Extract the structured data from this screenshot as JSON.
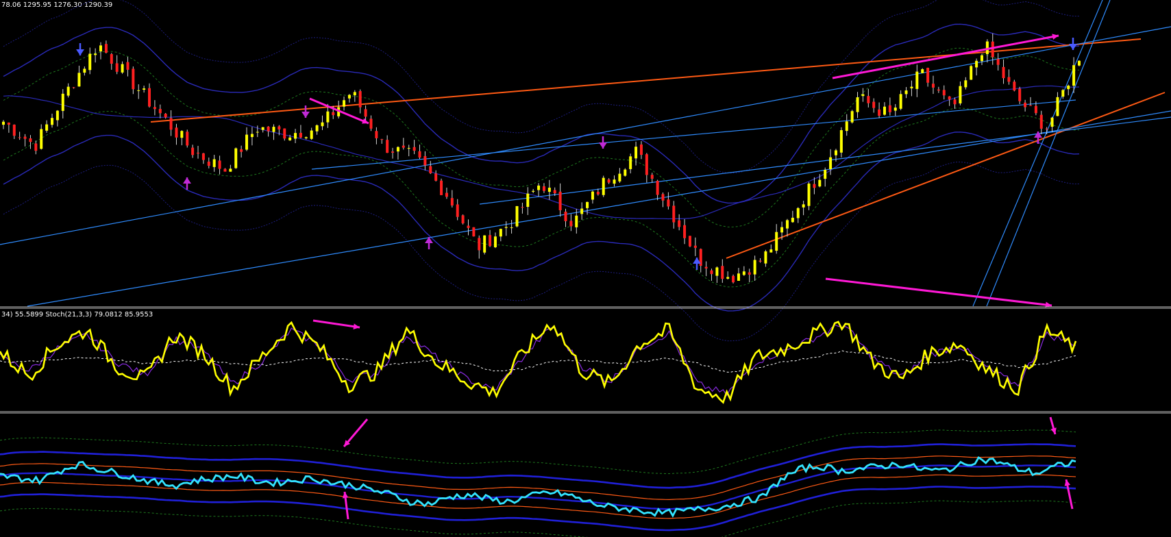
{
  "chart_data": [
    {
      "type": "candlestick",
      "pane": "price",
      "header_text": "78.06 1295.95 1276.30 1290.39",
      "colors": {
        "up": "#ffff00",
        "down": "#ff2020",
        "wick": "#d8d8d8",
        "band_outer": "#2a2ab8",
        "band_inner": "#1d1d80",
        "band_green": "#1e7a1e",
        "trend_orange": "#ff5a14",
        "trend_blue": "#2f8cff",
        "highlight_magenta": "#ff19d6",
        "marker_blue": "#4a5aff",
        "marker_purple": "#c02ad6"
      },
      "ohlc_sampled": [
        {
          "o": 1281,
          "h": 1283,
          "l": 1279,
          "c": 1282
        },
        {
          "o": 1279,
          "h": 1281,
          "l": 1277,
          "c": 1278
        },
        {
          "o": 1285,
          "h": 1288,
          "l": 1284,
          "c": 1287
        },
        {
          "o": 1293,
          "h": 1296,
          "l": 1292,
          "c": 1295
        },
        {
          "o": 1290,
          "h": 1292,
          "l": 1288,
          "c": 1289
        },
        {
          "o": 1284,
          "h": 1286,
          "l": 1282,
          "c": 1283
        },
        {
          "o": 1278,
          "h": 1280,
          "l": 1276,
          "c": 1277
        },
        {
          "o": 1272,
          "h": 1275,
          "l": 1271,
          "c": 1274
        },
        {
          "o": 1279,
          "h": 1282,
          "l": 1278,
          "c": 1281
        },
        {
          "o": 1281,
          "h": 1283,
          "l": 1279,
          "c": 1280
        },
        {
          "o": 1280,
          "h": 1282,
          "l": 1279,
          "c": 1281
        },
        {
          "o": 1286,
          "h": 1288,
          "l": 1285,
          "c": 1287
        },
        {
          "o": 1278,
          "h": 1281,
          "l": 1277,
          "c": 1278
        },
        {
          "o": 1277,
          "h": 1279,
          "l": 1275,
          "c": 1276
        },
        {
          "o": 1271,
          "h": 1273,
          "l": 1269,
          "c": 1270
        },
        {
          "o": 1262,
          "h": 1265,
          "l": 1259,
          "c": 1261
        },
        {
          "o": 1264,
          "h": 1266,
          "l": 1262,
          "c": 1265
        },
        {
          "o": 1270,
          "h": 1273,
          "l": 1269,
          "c": 1272
        },
        {
          "o": 1266,
          "h": 1268,
          "l": 1264,
          "c": 1265
        },
        {
          "o": 1270,
          "h": 1273,
          "l": 1269,
          "c": 1272
        },
        {
          "o": 1274,
          "h": 1278,
          "l": 1273,
          "c": 1277
        },
        {
          "o": 1268,
          "h": 1271,
          "l": 1267,
          "c": 1268
        },
        {
          "o": 1260,
          "h": 1262,
          "l": 1258,
          "c": 1259
        },
        {
          "o": 1256,
          "h": 1258,
          "l": 1254,
          "c": 1256
        },
        {
          "o": 1258,
          "h": 1260,
          "l": 1256,
          "c": 1259
        },
        {
          "o": 1265,
          "h": 1268,
          "l": 1264,
          "c": 1267
        },
        {
          "o": 1272,
          "h": 1276,
          "l": 1271,
          "c": 1275
        },
        {
          "o": 1282,
          "h": 1288,
          "l": 1281,
          "c": 1286
        },
        {
          "o": 1284,
          "h": 1287,
          "l": 1282,
          "c": 1283
        },
        {
          "o": 1288,
          "h": 1291,
          "l": 1287,
          "c": 1290
        },
        {
          "o": 1285,
          "h": 1287,
          "l": 1283,
          "c": 1284
        },
        {
          "o": 1292,
          "h": 1296,
          "l": 1291,
          "c": 1295
        },
        {
          "o": 1287,
          "h": 1289,
          "l": 1285,
          "c": 1286
        },
        {
          "o": 1282,
          "h": 1284,
          "l": 1280,
          "c": 1281
        },
        {
          "o": 1290,
          "h": 1294,
          "l": 1289,
          "c": 1293
        }
      ],
      "price_range": [
        1252,
        1300
      ]
    },
    {
      "type": "line",
      "pane": "stochastic",
      "header_text": "34) 55.5899  Stoch(21,3,3) 79.0812 85.9553",
      "colors": {
        "main": "#ffff00",
        "signal": "#8a2be2",
        "avg": "#ffffff"
      },
      "ylim": [
        0,
        100
      ],
      "main_values": [
        60,
        35,
        70,
        85,
        45,
        30,
        80,
        60,
        20,
        55,
        90,
        65,
        25,
        40,
        85,
        50,
        30,
        15,
        60,
        95,
        40,
        25,
        70,
        85,
        20,
        10,
        55,
        65,
        80,
        95,
        50,
        30,
        60,
        70,
        40,
        20,
        85,
        65
      ],
      "signal_values": [
        55,
        40,
        65,
        80,
        50,
        35,
        75,
        62,
        25,
        50,
        85,
        68,
        30,
        38,
        80,
        55,
        32,
        18,
        55,
        90,
        45,
        28,
        65,
        82,
        25,
        14,
        50,
        62,
        76,
        92,
        55,
        33,
        58,
        68,
        42,
        24,
        80,
        70
      ],
      "avg_values": [
        50,
        50,
        52,
        55,
        52,
        48,
        50,
        52,
        48,
        46,
        50,
        55,
        52,
        46,
        48,
        52,
        48,
        40,
        42,
        50,
        52,
        48,
        50,
        54,
        48,
        38,
        42,
        50,
        55,
        62,
        58,
        50,
        48,
        52,
        50,
        44,
        48,
        56
      ]
    },
    {
      "type": "line",
      "pane": "lower_oscillator",
      "colors": {
        "main": "#33e4ff",
        "band": "#2020d8",
        "orange": "#ff5a14",
        "green": "#1e7a1e",
        "highlight_magenta": "#ff19d6"
      },
      "ylim": [
        0,
        100
      ],
      "main_values": [
        52,
        50,
        48,
        56,
        62,
        58,
        54,
        50,
        46,
        44,
        48,
        50,
        52,
        48,
        46,
        48,
        50,
        46,
        44,
        40,
        36,
        30,
        28,
        34,
        36,
        32,
        30,
        34,
        38,
        36,
        30,
        26,
        24,
        22,
        20,
        22,
        24,
        26,
        30,
        34,
        50,
        58,
        60,
        56,
        58,
        60,
        62,
        58,
        56,
        60,
        66,
        64,
        58,
        54,
        60,
        64
      ]
    }
  ]
}
